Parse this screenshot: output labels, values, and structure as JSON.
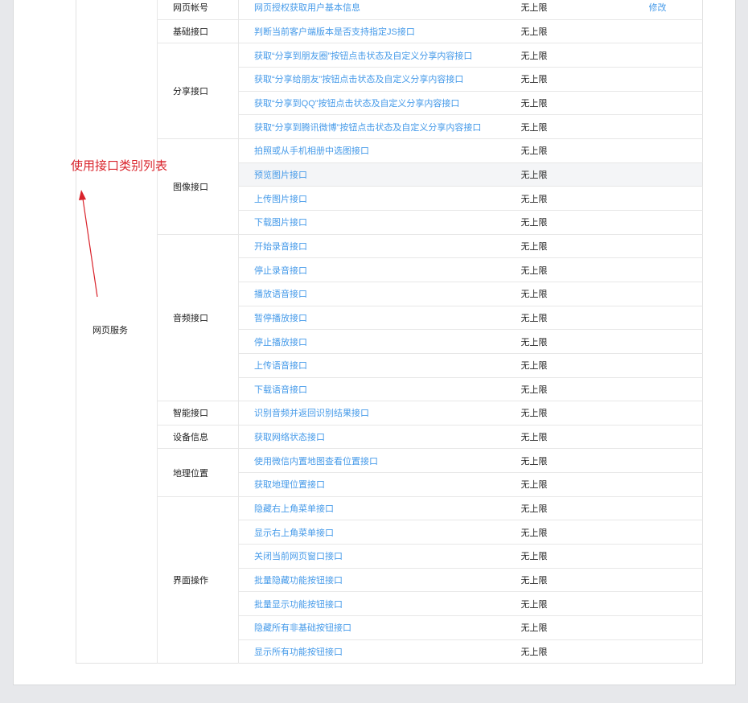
{
  "annotation": {
    "label": "使用接口类别列表",
    "color": "#d9232b"
  },
  "colors": {
    "link": "#459ae9",
    "page_background": "#e7e8eb",
    "highlight_row": "#f4f5f7"
  },
  "table": {
    "module_label": "网页服务",
    "edit_label": "修改",
    "limit_label": "无上限",
    "highlighted_api": "预览图片接口",
    "categories": [
      {
        "name": "网页帐号",
        "apis": [
          "网页授权获取用户基本信息"
        ]
      },
      {
        "name": "基础接口",
        "apis": [
          "判断当前客户端版本是否支持指定JS接口"
        ]
      },
      {
        "name": "分享接口",
        "apis": [
          "获取“分享到朋友圈”按钮点击状态及自定义分享内容接口",
          "获取“分享给朋友”按钮点击状态及自定义分享内容接口",
          "获取“分享到QQ”按钮点击状态及自定义分享内容接口",
          "获取“分享到腾讯微博”按钮点击状态及自定义分享内容接口"
        ]
      },
      {
        "name": "图像接口",
        "apis": [
          "拍照或从手机相册中选图接口",
          "预览图片接口",
          "上传图片接口",
          "下载图片接口"
        ]
      },
      {
        "name": "音频接口",
        "apis": [
          "开始录音接口",
          "停止录音接口",
          "播放语音接口",
          "暂停播放接口",
          "停止播放接口",
          "上传语音接口",
          "下载语音接口"
        ]
      },
      {
        "name": "智能接口",
        "apis": [
          "识别音频并返回识别结果接口"
        ]
      },
      {
        "name": "设备信息",
        "apis": [
          "获取网络状态接口"
        ]
      },
      {
        "name": "地理位置",
        "apis": [
          "使用微信内置地图查看位置接口",
          "获取地理位置接口"
        ]
      },
      {
        "name": "界面操作",
        "apis": [
          "隐藏右上角菜单接口",
          "显示右上角菜单接口",
          "关闭当前网页窗口接口",
          "批量隐藏功能按钮接口",
          "批量显示功能按钮接口",
          "隐藏所有非基础按钮接口",
          "显示所有功能按钮接口"
        ]
      }
    ]
  }
}
